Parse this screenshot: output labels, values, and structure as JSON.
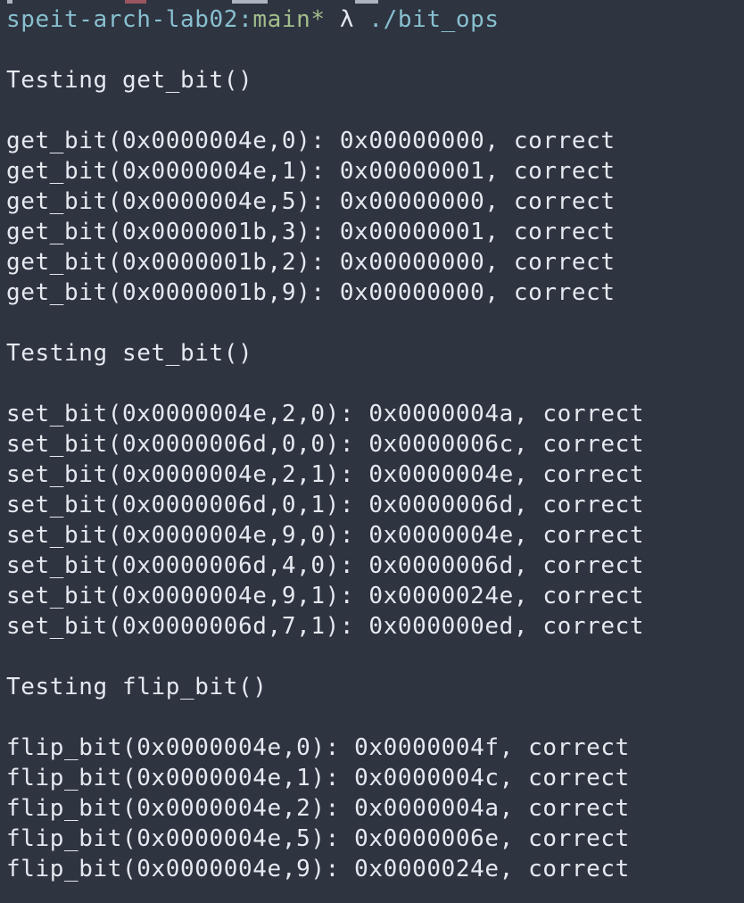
{
  "prompt": {
    "host": "speit-arch-lab02",
    "separator": ":",
    "branch": "main",
    "dirty_marker": "*",
    "symbol": "λ",
    "command": "./bit_ops"
  },
  "sections": [
    {
      "heading": "Testing get_bit()",
      "lines": [
        "get_bit(0x0000004e,0): 0x00000000, correct",
        "get_bit(0x0000004e,1): 0x00000001, correct",
        "get_bit(0x0000004e,5): 0x00000000, correct",
        "get_bit(0x0000001b,3): 0x00000001, correct",
        "get_bit(0x0000001b,2): 0x00000000, correct",
        "get_bit(0x0000001b,9): 0x00000000, correct"
      ]
    },
    {
      "heading": "Testing set_bit()",
      "lines": [
        "set_bit(0x0000004e,2,0): 0x0000004a, correct",
        "set_bit(0x0000006d,0,0): 0x0000006c, correct",
        "set_bit(0x0000004e,2,1): 0x0000004e, correct",
        "set_bit(0x0000006d,0,1): 0x0000006d, correct",
        "set_bit(0x0000004e,9,0): 0x0000004e, correct",
        "set_bit(0x0000006d,4,0): 0x0000006d, correct",
        "set_bit(0x0000004e,9,1): 0x0000024e, correct",
        "set_bit(0x0000006d,7,1): 0x000000ed, correct"
      ]
    },
    {
      "heading": "Testing flip_bit()",
      "lines": [
        "flip_bit(0x0000004e,0): 0x0000004f, correct",
        "flip_bit(0x0000004e,1): 0x0000004c, correct",
        "flip_bit(0x0000004e,2): 0x0000004a, correct",
        "flip_bit(0x0000004e,5): 0x0000006e, correct",
        "flip_bit(0x0000004e,9): 0x0000024e, correct"
      ]
    }
  ]
}
